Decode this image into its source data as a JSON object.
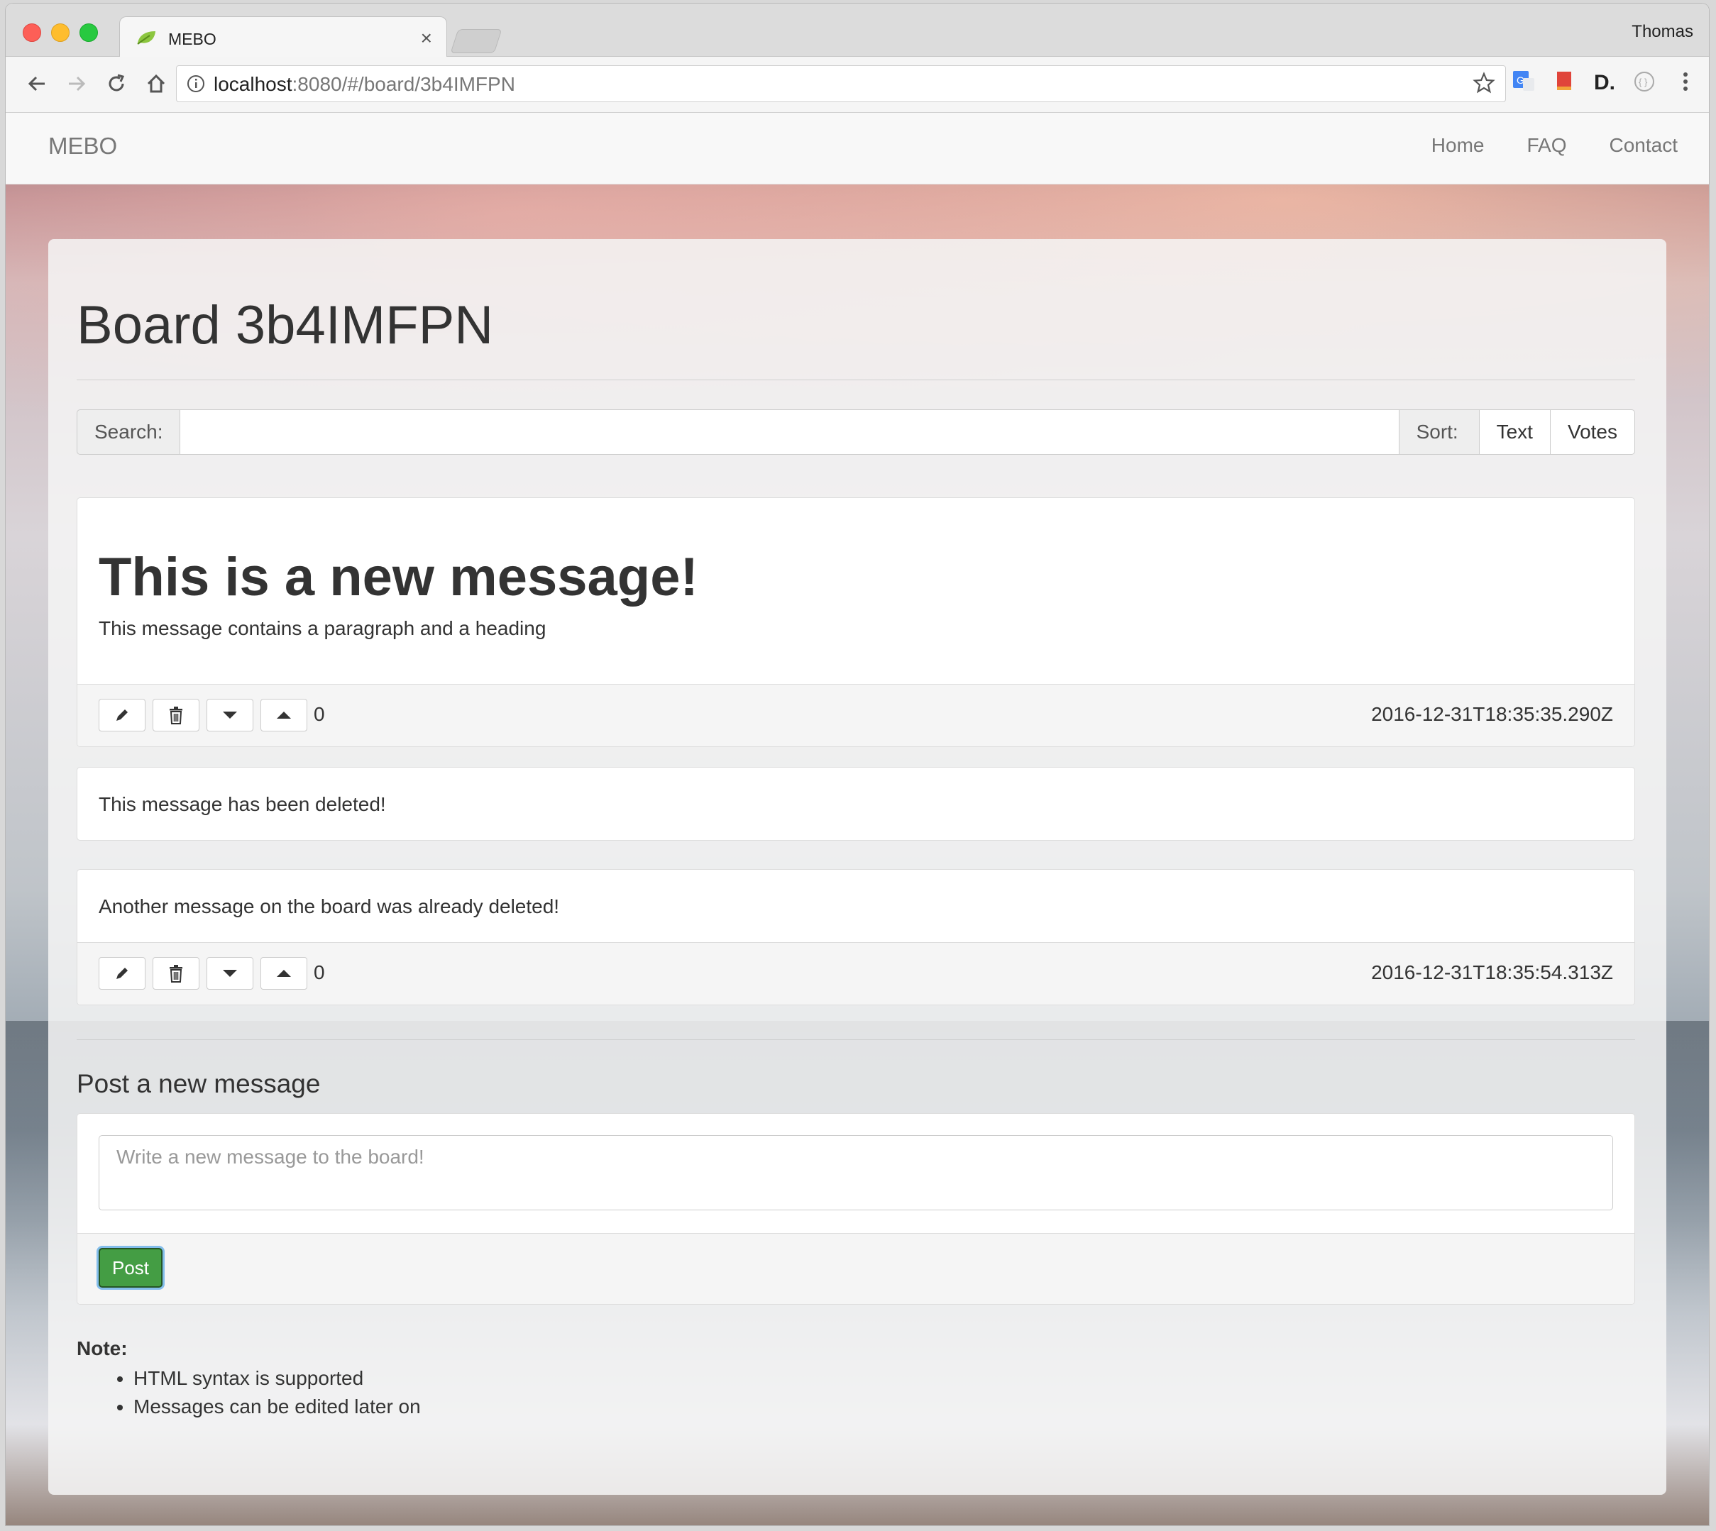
{
  "browser": {
    "tab_title": "MEBO",
    "tab_close": "×",
    "profile_name": "Thomas",
    "url_host": "localhost",
    "url_rest": ":8080/#/board/3b4IMFPN"
  },
  "navbar": {
    "brand": "MEBO",
    "links": [
      "Home",
      "FAQ",
      "Contact"
    ]
  },
  "board": {
    "title": "Board 3b4IMFPN",
    "search_label": "Search:",
    "search_value": "",
    "sort_label": "Sort:",
    "sort_options": [
      "Text",
      "Votes"
    ]
  },
  "messages": [
    {
      "heading": "This is a new message!",
      "text": "This message contains a paragraph and a heading",
      "votes": "0",
      "timestamp": "2016-12-31T18:35:35.290Z"
    },
    {
      "text": "This message has been deleted!"
    },
    {
      "text": "Another message on the board was already deleted!",
      "votes": "0",
      "timestamp": "2016-12-31T18:35:54.313Z"
    }
  ],
  "compose": {
    "title": "Post a new message",
    "placeholder": "Write a new message to the board!",
    "post_label": "Post"
  },
  "note": {
    "title": "Note:",
    "items": [
      "HTML syntax is supported",
      "Messages can be edited later on"
    ]
  },
  "icons": {
    "edit": "pencil-icon",
    "delete": "trash-icon",
    "downvote": "caret-down-icon",
    "upvote": "caret-up-icon"
  },
  "colors": {
    "post_button": "#449d44",
    "navbar_bg": "#f8f8f8"
  }
}
